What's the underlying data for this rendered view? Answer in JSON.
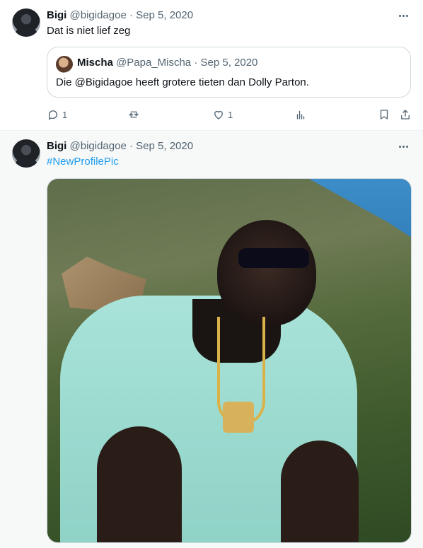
{
  "tweets": [
    {
      "user": {
        "name": "Bigi",
        "handle": "@bigidagoe"
      },
      "separator": "·",
      "date": "Sep 5, 2020",
      "text": "Dat is niet lief zeg",
      "quote": {
        "user": {
          "name": "Mischa",
          "handle": "@Papa_Mischa"
        },
        "separator": "·",
        "date": "Sep 5, 2020",
        "text": "Die @Bigidagoe heeft grotere tieten dan Dolly Parton."
      },
      "actions": {
        "replies": "1",
        "retweets": "",
        "likes": "1"
      },
      "icons": [
        "more-icon",
        "reply-icon",
        "retweet-icon",
        "like-icon",
        "analytics-icon",
        "bookmark-icon",
        "share-icon"
      ]
    },
    {
      "user": {
        "name": "Bigi",
        "handle": "@bigidagoe"
      },
      "separator": "·",
      "date": "Sep 5, 2020",
      "hashtag": "#NewProfilePic"
    }
  ],
  "colors": {
    "text": "#0f1419",
    "muted": "#536471",
    "link": "#1d9bf0",
    "border": "#cfd9de",
    "background_alt": "#f7f9f9"
  }
}
